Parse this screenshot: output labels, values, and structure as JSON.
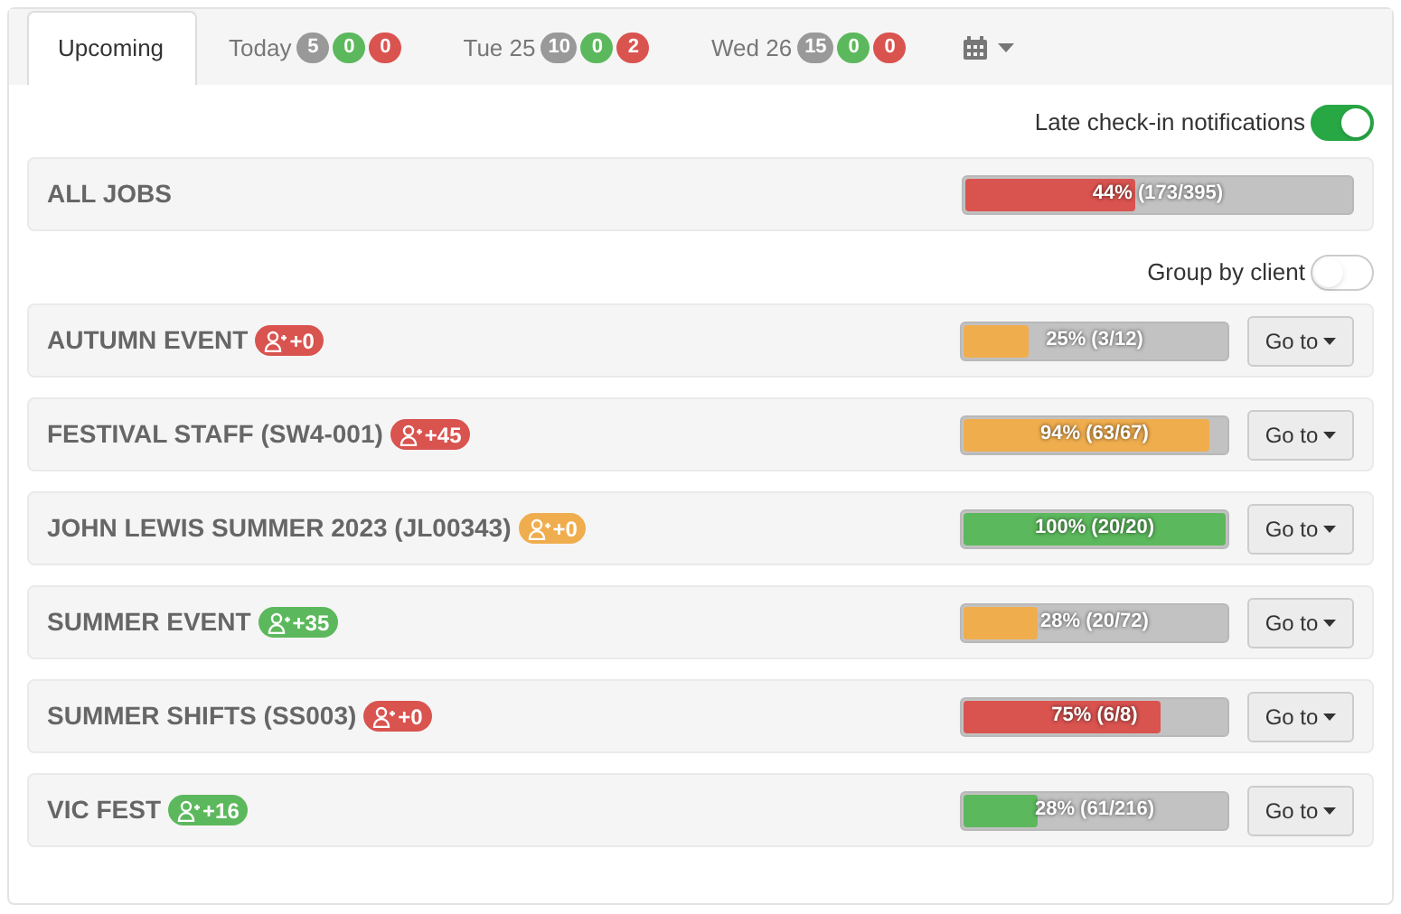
{
  "tabs": [
    {
      "label": "Upcoming",
      "selected": true
    },
    {
      "label": "Today",
      "selected": false,
      "counts": [
        {
          "text": "5",
          "color": "#999999"
        },
        {
          "text": "0",
          "color": "#5cb85c"
        },
        {
          "text": "0",
          "color": "#d9534f"
        }
      ]
    },
    {
      "label": "Tue 25",
      "selected": false,
      "counts": [
        {
          "text": "10",
          "color": "#999999"
        },
        {
          "text": "0",
          "color": "#5cb85c"
        },
        {
          "text": "2",
          "color": "#d9534f"
        }
      ]
    },
    {
      "label": "Wed 26",
      "selected": false,
      "counts": [
        {
          "text": "15",
          "color": "#999999"
        },
        {
          "text": "0",
          "color": "#5cb85c"
        },
        {
          "text": "0",
          "color": "#d9534f"
        }
      ]
    }
  ],
  "late_checkin": {
    "label": "Late check-in notifications",
    "on": true
  },
  "all_jobs": {
    "title": "ALL JOBS",
    "level": 0.44,
    "reading": "44% (173/395)",
    "color": "#d9534f"
  },
  "group_by_client": {
    "label": "Group by client",
    "on": false
  },
  "jobs": [
    {
      "title": "AUTUMN EVENT",
      "badge": {
        "text": "+0",
        "color": "#d9534f"
      },
      "level": 0.25,
      "reading": "25% (3/12)",
      "color": "#f0ad4e",
      "button": "Go to"
    },
    {
      "title": "FESTIVAL STAFF (SW4-001)",
      "badge": {
        "text": "+45",
        "color": "#d9534f"
      },
      "level": 0.94,
      "reading": "94% (63/67)",
      "color": "#f0ad4e",
      "button": "Go to"
    },
    {
      "title": "JOHN LEWIS SUMMER 2023 (JL00343)",
      "badge": {
        "text": "+0",
        "color": "#f0ad4e"
      },
      "level": 1,
      "reading": "100% (20/20)",
      "color": "#5cb85c",
      "button": "Go to"
    },
    {
      "title": "SUMMER EVENT",
      "badge": {
        "text": "+35",
        "color": "#5cb85c"
      },
      "level": 0.28,
      "reading": "28% (20/72)",
      "color": "#f0ad4e",
      "button": "Go to"
    },
    {
      "title": "SUMMER SHIFTS (SS003)",
      "badge": {
        "text": "+0",
        "color": "#d9534f"
      },
      "level": 0.75,
      "reading": "75% (6/8)",
      "color": "#d9534f",
      "button": "Go to"
    },
    {
      "title": "VIC FEST",
      "badge": {
        "text": "+16",
        "color": "#5cb85c"
      },
      "level": 0.28,
      "reading": "28% (61/216)",
      "color": "#5cb85c",
      "button": "Go to"
    }
  ]
}
